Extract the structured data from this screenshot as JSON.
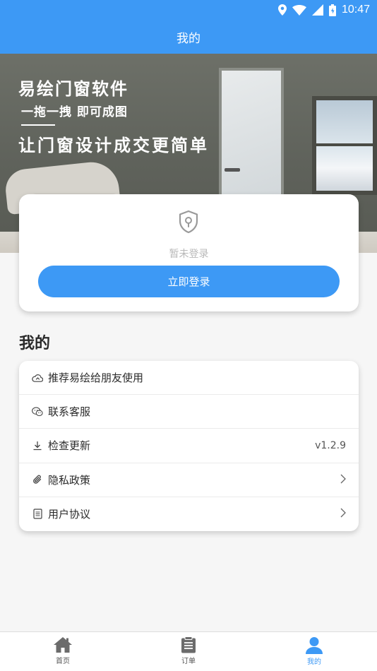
{
  "status_bar": {
    "time": "10:47"
  },
  "header": {
    "title": "我的"
  },
  "banner": {
    "title": "易绘门窗软件",
    "subtitle": "一拖一拽 即可成图",
    "slogan": "让门窗设计成交更简单"
  },
  "login": {
    "status_text": "暂未登录",
    "button_label": "立即登录"
  },
  "section": {
    "title": "我的"
  },
  "menu": {
    "items": [
      {
        "label": "推荐易绘给朋友使用",
        "icon": "share-cloud-icon"
      },
      {
        "label": "联系客服",
        "icon": "wechat-icon"
      },
      {
        "label": "检查更新",
        "icon": "download-icon",
        "value": "v1.2.9"
      },
      {
        "label": "隐私政策",
        "icon": "paperclip-icon"
      },
      {
        "label": "用户协议",
        "icon": "document-icon"
      }
    ]
  },
  "tabs": [
    {
      "label": "首页",
      "icon": "home-icon"
    },
    {
      "label": "订单",
      "icon": "clipboard-icon"
    },
    {
      "label": "我的",
      "icon": "user-icon",
      "active": true
    }
  ],
  "colors": {
    "primary": "#3d99f5",
    "background": "#f6f6f6",
    "muted_text": "#b9b9b9"
  }
}
